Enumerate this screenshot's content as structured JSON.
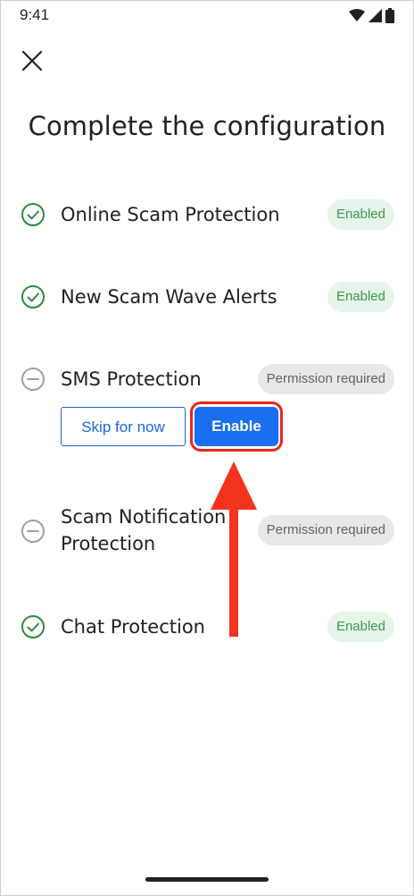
{
  "status_bar": {
    "time": "9:41"
  },
  "header": {
    "title": "Complete the configuration"
  },
  "items": [
    {
      "label": "Online Scam Protection",
      "status": "Enabled",
      "state": "enabled"
    },
    {
      "label": "New Scam Wave Alerts",
      "status": "Enabled",
      "state": "enabled"
    },
    {
      "label": "SMS Protection",
      "status": "Permission required",
      "state": "pending"
    },
    {
      "label_line1": "Scam Notification",
      "label_line2": "Protection",
      "status": "Permission required",
      "state": "pending"
    },
    {
      "label": "Chat Protection",
      "status": "Enabled",
      "state": "enabled"
    }
  ],
  "actions": {
    "skip_label": "Skip for now",
    "enable_label": "Enable"
  },
  "colors": {
    "accent": "#1a6ff0",
    "success": "#3c9a4f",
    "annotation": "#e8261c"
  }
}
